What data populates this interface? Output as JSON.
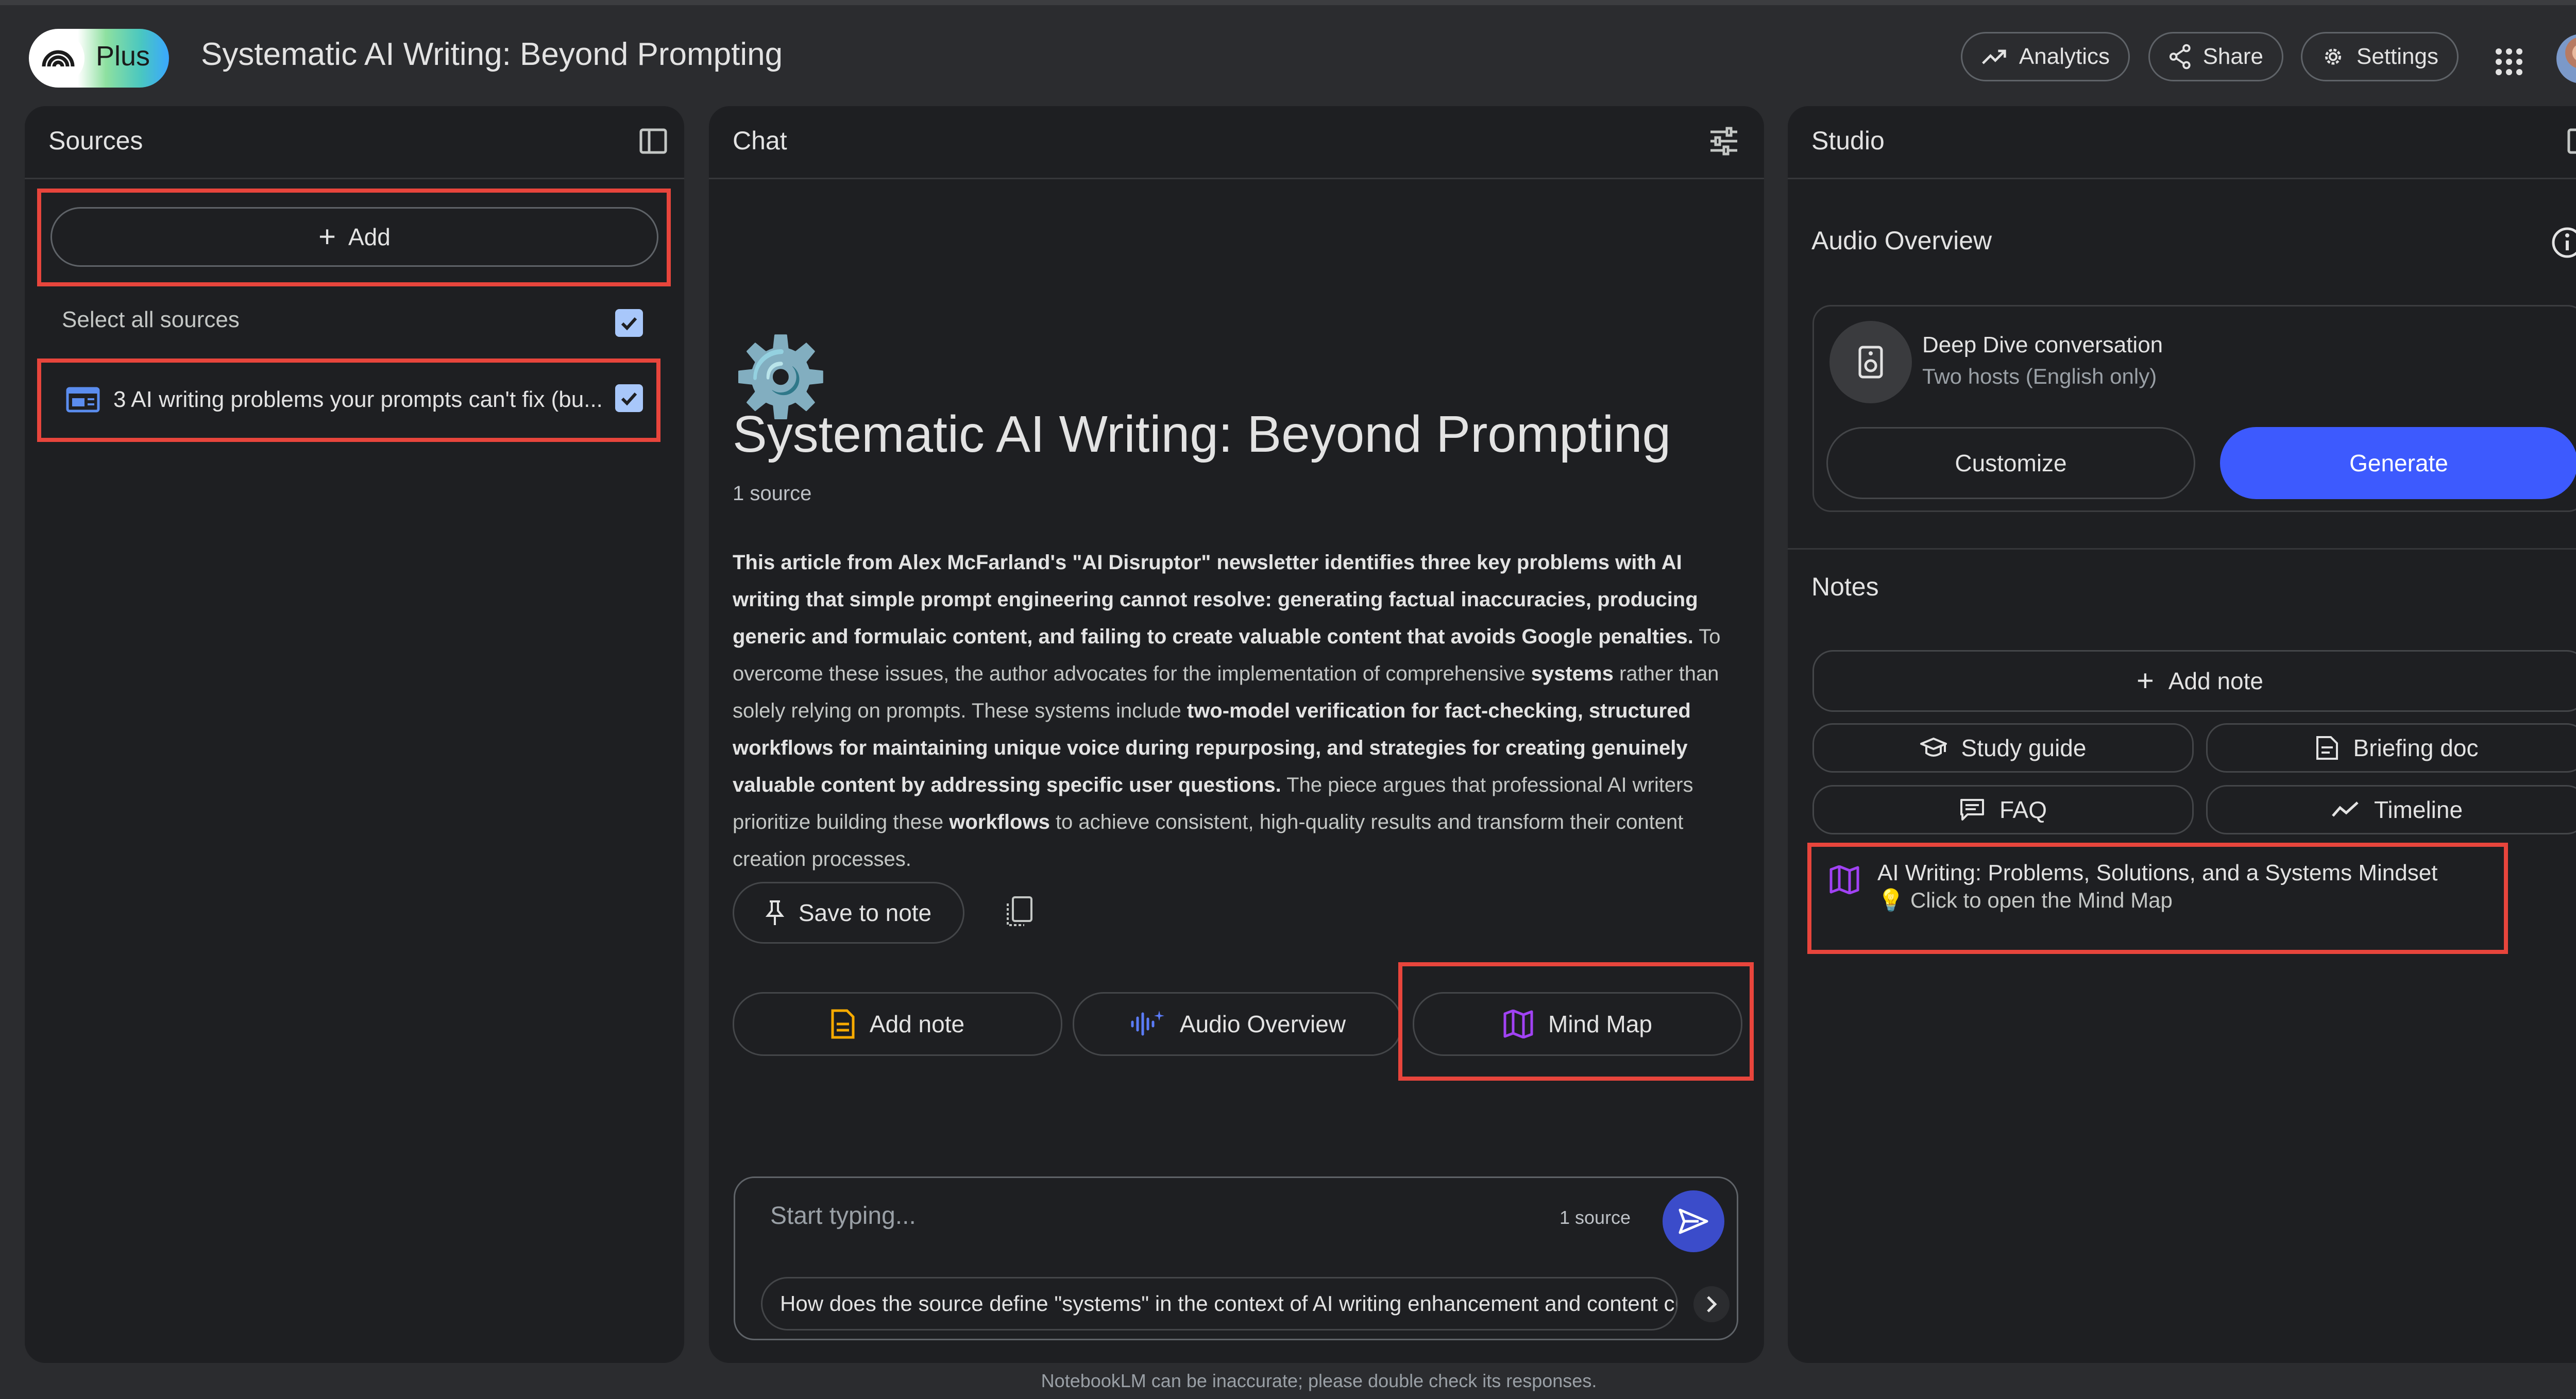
{
  "header": {
    "logo_label": "Plus",
    "title": "Systematic AI Writing: Beyond Prompting",
    "analytics_label": "Analytics",
    "share_label": "Share",
    "settings_label": "Settings"
  },
  "sources": {
    "title": "Sources",
    "add_label": "Add",
    "select_all_label": "Select all sources",
    "items": [
      {
        "label": "3 AI writing problems your prompts can't fix (bu...",
        "checked": true
      }
    ]
  },
  "chat": {
    "title": "Chat",
    "emoji": "⚙️",
    "notebook_title": "Systematic AI Writing: Beyond Prompting",
    "source_count": "1 source",
    "summary": {
      "b1": "This article from Alex McFarland's \"AI Disruptor\" newsletter identifies three key problems with AI writing that simple prompt engineering cannot resolve: generating factual inaccuracies, producing generic and formulaic content, and failing to create valuable content that avoids Google penalties.",
      "t1": " To overcome these issues, the author advocates for the implementation of comprehensive ",
      "b2": "systems",
      "t2": " rather than solely relying on prompts. These systems include ",
      "b3": "two-model verification for fact-checking, structured workflows for maintaining unique voice during repurposing, and strategies for creating genuinely valuable content by addressing specific user questions.",
      "t3": " The piece argues that professional AI writers prioritize building these ",
      "b4": "workflows",
      "t4": " to achieve consistent, high-quality results and transform their content creation processes."
    },
    "save_to_note_label": "Save to note",
    "actions": {
      "add_note": "Add note",
      "audio_overview": "Audio Overview",
      "mind_map": "Mind Map"
    },
    "input_placeholder": "Start typing...",
    "input_source_count": "1 source",
    "suggestion": "How does the source define \"systems\" in the context of AI writing enhancement and content creation?"
  },
  "studio": {
    "title": "Studio",
    "audio_overview_title": "Audio Overview",
    "deep_dive_title": "Deep Dive conversation",
    "deep_dive_subtitle": "Two hosts (English only)",
    "customize_label": "Customize",
    "generate_label": "Generate",
    "notes_title": "Notes",
    "add_note_label": "Add note",
    "study_guide_label": "Study guide",
    "briefing_doc_label": "Briefing doc",
    "faq_label": "FAQ",
    "timeline_label": "Timeline",
    "note_item_title": "AI Writing: Problems, Solutions, and a Systems Mindset",
    "note_item_emoji": "💡",
    "note_item_subtitle": "Click to open the Mind Map"
  },
  "footer": {
    "disclaimer": "NotebookLM can be inaccurate; please double check its responses."
  },
  "colors": {
    "background": "#2b2c2f",
    "panel": "#1e1f22",
    "generate_button": "#3d5afe",
    "send_button": "#3b4cca",
    "highlight_box": "#e8453c",
    "mind_map_icon": "#a142f4",
    "add_note_icon": "#f9ab00",
    "audio_icon": "#5b7cfa",
    "checkbox": "#a8c7fa"
  }
}
